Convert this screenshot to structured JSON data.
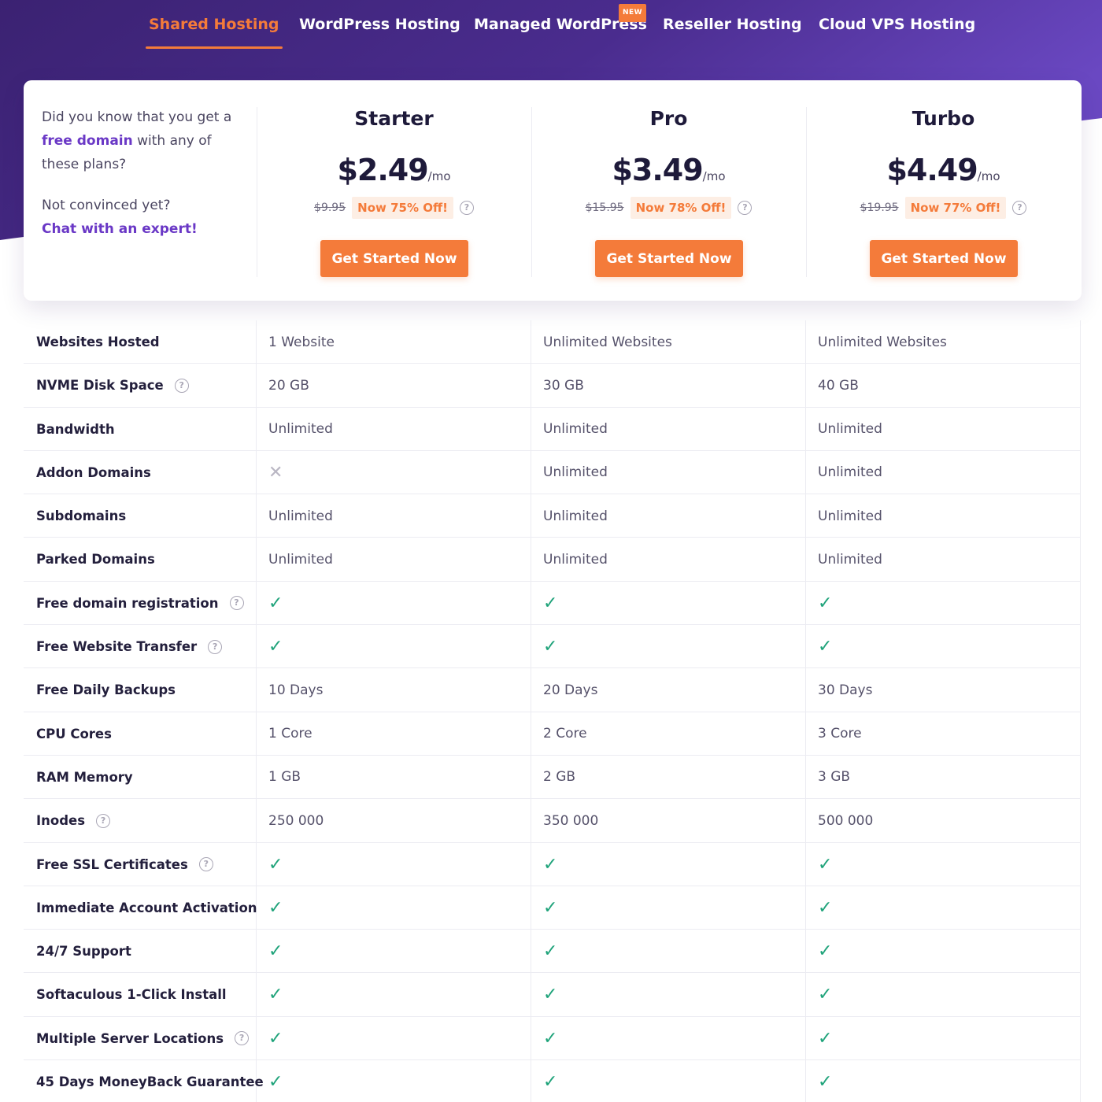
{
  "nav": {
    "tabs": [
      {
        "label": "Shared Hosting",
        "active": true
      },
      {
        "label": "WordPress Hosting",
        "active": false
      },
      {
        "label": "Managed WordPress",
        "active": false,
        "badge": "NEW"
      },
      {
        "label": "Reseller Hosting",
        "active": false
      },
      {
        "label": "Cloud VPS Hosting",
        "active": false
      }
    ]
  },
  "intro": {
    "line1_pre": "Did you know that you get a ",
    "line1_hl": "free domain",
    "line1_post": " with any of these plans?",
    "line2": "Not convinced yet?",
    "chat_link": "Chat with an expert!"
  },
  "plans": [
    {
      "name": "Starter",
      "price": "$2.49",
      "per": "/mo",
      "old_price": "$9.95",
      "discount": "Now 75% Off!",
      "cta": "Get Started Now"
    },
    {
      "name": "Pro",
      "price": "$3.49",
      "per": "/mo",
      "old_price": "$15.95",
      "discount": "Now 78% Off!",
      "cta": "Get Started Now"
    },
    {
      "name": "Turbo",
      "price": "$4.49",
      "per": "/mo",
      "old_price": "$19.95",
      "discount": "Now 77% Off!",
      "cta": "Get Started Now"
    }
  ],
  "help_icon": "?",
  "check_icon": "✓",
  "cross_icon": "✕",
  "features": [
    {
      "label": "Websites Hosted",
      "help": false,
      "values": [
        "1 Website",
        "Unlimited Websites",
        "Unlimited Websites"
      ]
    },
    {
      "label": "NVME Disk Space",
      "help": true,
      "values": [
        "20 GB",
        "30 GB",
        "40 GB"
      ]
    },
    {
      "label": "Bandwidth",
      "help": false,
      "values": [
        "Unlimited",
        "Unlimited",
        "Unlimited"
      ]
    },
    {
      "label": "Addon Domains",
      "help": false,
      "values": [
        "cross",
        "Unlimited",
        "Unlimited"
      ]
    },
    {
      "label": "Subdomains",
      "help": false,
      "values": [
        "Unlimited",
        "Unlimited",
        "Unlimited"
      ]
    },
    {
      "label": "Parked Domains",
      "help": false,
      "values": [
        "Unlimited",
        "Unlimited",
        "Unlimited"
      ]
    },
    {
      "label": "Free domain registration",
      "help": true,
      "values": [
        "check",
        "check",
        "check"
      ]
    },
    {
      "label": "Free Website Transfer",
      "help": true,
      "values": [
        "check",
        "check",
        "check"
      ]
    },
    {
      "label": "Free Daily Backups",
      "help": false,
      "values": [
        "10 Days",
        "20 Days",
        "30 Days"
      ]
    },
    {
      "label": "CPU Cores",
      "help": false,
      "values": [
        "1 Core",
        "2 Core",
        "3 Core"
      ]
    },
    {
      "label": "RAM Memory",
      "help": false,
      "values": [
        "1 GB",
        "2 GB",
        "3 GB"
      ]
    },
    {
      "label": "Inodes",
      "help": true,
      "values": [
        "250 000",
        "350 000",
        "500 000"
      ]
    },
    {
      "label": "Free SSL Certificates",
      "help": true,
      "values": [
        "check",
        "check",
        "check"
      ]
    },
    {
      "label": "Immediate Account Activation",
      "help": false,
      "values": [
        "check",
        "check",
        "check"
      ]
    },
    {
      "label": "24/7 Support",
      "help": false,
      "values": [
        "check",
        "check",
        "check"
      ]
    },
    {
      "label": "Softaculous 1-Click Install",
      "help": false,
      "values": [
        "check",
        "check",
        "check"
      ]
    },
    {
      "label": "Multiple Server Locations",
      "help": true,
      "values": [
        "check",
        "check",
        "check"
      ]
    },
    {
      "label": "45 Days MoneyBack Guarantee",
      "help": false,
      "values": [
        "check",
        "check",
        "check"
      ]
    }
  ],
  "colors": {
    "accent": "#f47b3a",
    "purple_dark": "#3d2374",
    "purple_light": "#6a46c0",
    "check": "#1fa37a",
    "link": "#6a38c6"
  }
}
